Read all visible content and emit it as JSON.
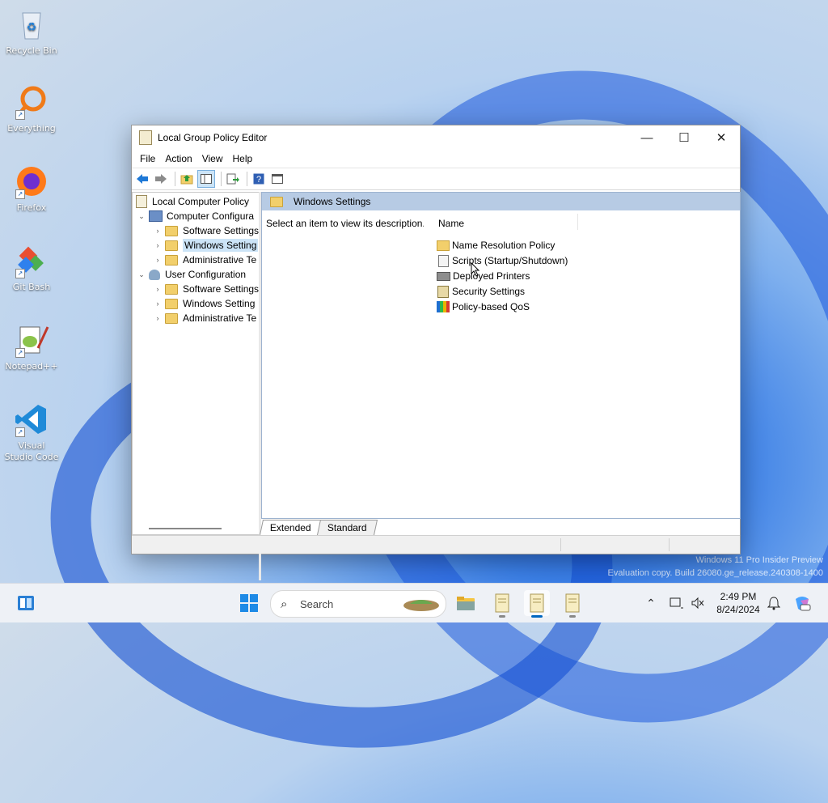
{
  "desktop": {
    "icons": [
      {
        "label": "Recycle Bin",
        "icon": "recycle-bin-icon"
      },
      {
        "label": "Everything",
        "icon": "search-magnifier-icon"
      },
      {
        "label": "Firefox",
        "icon": "firefox-icon"
      },
      {
        "label": "Git Bash",
        "icon": "git-icon"
      },
      {
        "label": "Notepad++",
        "icon": "notepad-icon"
      },
      {
        "label": "Visual Studio Code",
        "icon": "vscode-icon"
      }
    ],
    "watermark": {
      "line1": "Windows 11 Pro Insider Preview",
      "line2": "Evaluation copy. Build 26080.ge_release.240308-1400"
    }
  },
  "window": {
    "title": "Local Group Policy Editor",
    "controls": {
      "minimize": "—",
      "maximize": "☐",
      "close": "✕"
    },
    "menu": [
      "File",
      "Action",
      "View",
      "Help"
    ],
    "toolbar_icons": [
      "back-arrow-icon",
      "forward-arrow-icon",
      "up-folder-icon",
      "show-hide-tree-icon",
      "export-list-icon",
      "help-icon",
      "properties-icon"
    ],
    "tree": {
      "root": "Local Computer Policy",
      "computer": "Computer Configura",
      "computer_children": [
        "Software Settings",
        "Windows Setting",
        "Administrative Te"
      ],
      "user": "User Configuration",
      "user_children": [
        "Software Settings",
        "Windows Setting",
        "Administrative Te"
      ]
    },
    "panel": {
      "header": "Windows Settings",
      "description": "Select an item to view its description.",
      "column_name": "Name",
      "items": [
        {
          "label": "Name Resolution Policy",
          "icon": "folder-icon"
        },
        {
          "label": "Scripts (Startup/Shutdown)",
          "icon": "script-icon"
        },
        {
          "label": "Deployed Printers",
          "icon": "printer-icon"
        },
        {
          "label": "Security Settings",
          "icon": "security-icon"
        },
        {
          "label": "Policy-based QoS",
          "icon": "qos-chart-icon"
        }
      ]
    },
    "tabs": [
      "Extended",
      "Standard"
    ]
  },
  "taskbar": {
    "search_placeholder": "Search",
    "clock_time": "2:49 PM",
    "clock_date": "8/24/2024"
  },
  "colors": {
    "selection": "#cce4f7",
    "header_band": "#b7cbe4",
    "accent": "#0067c0"
  }
}
